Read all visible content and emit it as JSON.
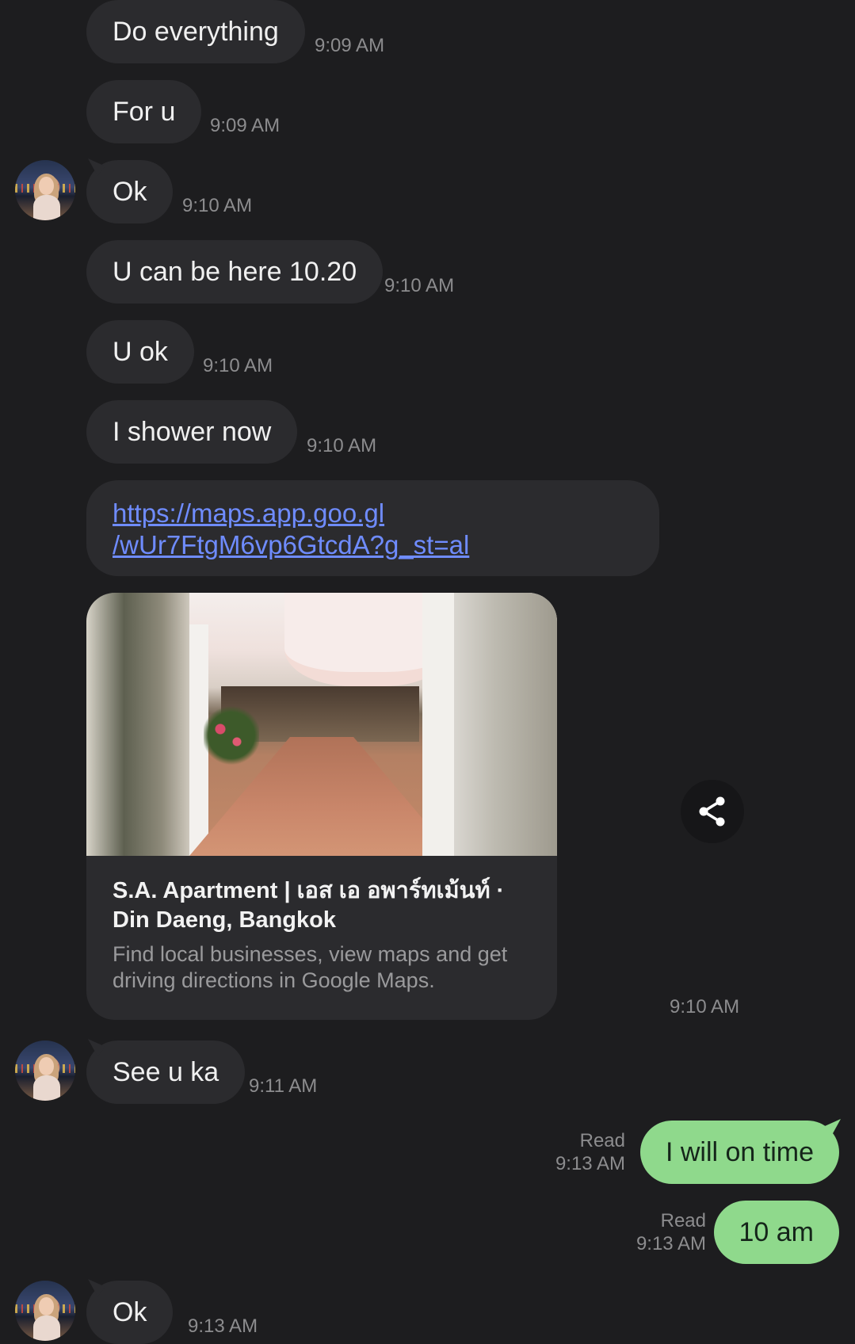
{
  "incoming_messages": [
    {
      "text": "Do everything",
      "time": "9:09 AM"
    },
    {
      "text": "For u",
      "time": "9:09 AM"
    },
    {
      "text": "Ok",
      "time": "9:10 AM"
    },
    {
      "text": "U can be here 10.20",
      "time": "9:10 AM"
    },
    {
      "text": "U ok",
      "time": "9:10 AM"
    },
    {
      "text": "I shower now",
      "time": "9:10 AM"
    }
  ],
  "link_message": {
    "line1": "https://maps.app.goo.gl",
    "line2": "/wUr7FtgM6vp6GtcdA?g_st=al"
  },
  "link_preview": {
    "title": "S.A. Apartment | เอส เอ อพาร์ทเม้นท์ · Din Daeng, Bangkok",
    "description": "Find local businesses, view maps and get driving directions in Google Maps.",
    "time": "9:10 AM",
    "share_icon": "share-icon"
  },
  "incoming_after": {
    "text": "See u ka",
    "time": "9:11 AM"
  },
  "outgoing_messages": [
    {
      "text": "I will on time",
      "status": "Read",
      "time": "9:13 AM"
    },
    {
      "text": "10 am",
      "status": "Read",
      "time": "9:13 AM"
    }
  ],
  "last_incoming": {
    "text": "Ok",
    "time": "9:13 AM"
  },
  "colors": {
    "background": "#1d1d1f",
    "incoming_bubble": "#2b2b2e",
    "outgoing_bubble": "#8fd98c",
    "link": "#6f8cff"
  }
}
